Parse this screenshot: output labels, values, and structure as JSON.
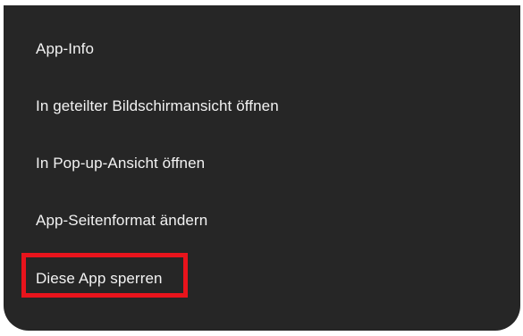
{
  "menu": {
    "items": [
      {
        "label": "App-Info"
      },
      {
        "label": "In geteilter Bildschirmansicht öffnen"
      },
      {
        "label": "In Pop-up-Ansicht öffnen"
      },
      {
        "label": "App-Seitenformat ändern"
      },
      {
        "label": "Diese App sperren"
      }
    ]
  },
  "colors": {
    "menu_background": "#262626",
    "text": "#f2f2f2",
    "highlight_border": "#e8141c"
  }
}
